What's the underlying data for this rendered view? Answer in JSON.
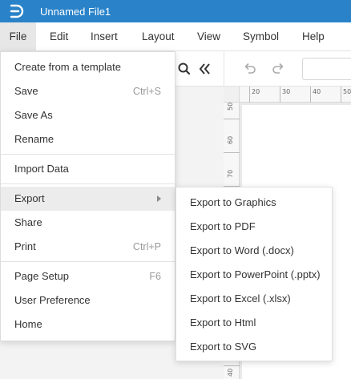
{
  "app": {
    "file_title": "Unnamed File1",
    "brand_color": "#2a83c9"
  },
  "menubar": [
    {
      "label": "File",
      "active": true
    },
    {
      "label": "Edit"
    },
    {
      "label": "Insert"
    },
    {
      "label": "Layout"
    },
    {
      "label": "View"
    },
    {
      "label": "Symbol"
    },
    {
      "label": "Help"
    }
  ],
  "toolbar": {
    "icons": [
      "search-icon",
      "collapse-double-chevron-icon",
      "undo-icon",
      "redo-icon"
    ]
  },
  "ruler": {
    "top_labels": [
      "20",
      "30",
      "40",
      "50"
    ],
    "left_labels": [
      "50",
      "60",
      "70",
      "40"
    ]
  },
  "file_menu": {
    "items": [
      {
        "label": "Create from a template",
        "shortcut": ""
      },
      {
        "label": "Save",
        "shortcut": "Ctrl+S"
      },
      {
        "label": "Save As",
        "shortcut": ""
      },
      {
        "label": "Rename",
        "shortcut": ""
      },
      {
        "label": "Import Data",
        "shortcut": ""
      },
      {
        "label": "Export",
        "shortcut": "",
        "submenu": true
      },
      {
        "label": "Share",
        "shortcut": ""
      },
      {
        "label": "Print",
        "shortcut": "Ctrl+P"
      },
      {
        "label": "Page Setup",
        "shortcut": "F6"
      },
      {
        "label": "User Preference",
        "shortcut": ""
      },
      {
        "label": "Home",
        "shortcut": ""
      }
    ]
  },
  "export_submenu": {
    "items": [
      "Export to Graphics",
      "Export to PDF",
      "Export to Word (.docx)",
      "Export to PowerPoint (.pptx)",
      "Export to Excel (.xlsx)",
      "Export to Html",
      "Export to SVG"
    ]
  }
}
